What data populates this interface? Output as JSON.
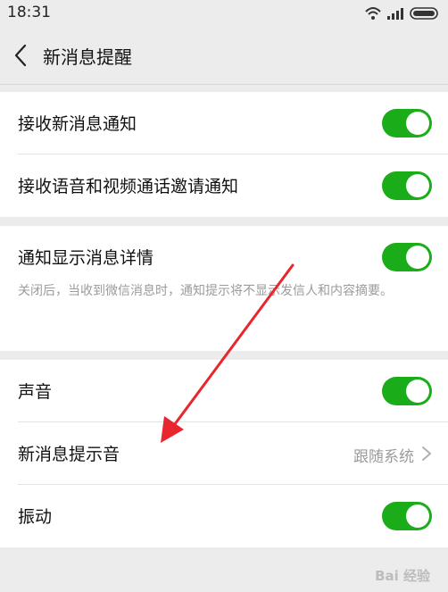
{
  "status_bar": {
    "time": "18:31"
  },
  "nav": {
    "title": "新消息提醒"
  },
  "group1": {
    "rows": [
      {
        "label": "接收新消息通知",
        "toggle": "on"
      },
      {
        "label": "接收语音和视频通话邀请通知",
        "toggle": "on"
      }
    ]
  },
  "group2": {
    "rows": [
      {
        "label": "通知显示消息详情",
        "toggle": "on",
        "description": "关闭后，当收到微信消息时，通知提示将不显示发信人和内容摘要。"
      }
    ]
  },
  "group3": {
    "rows": [
      {
        "label": "声音",
        "toggle": "on"
      },
      {
        "label": "新消息提示音",
        "value": "跟随系统"
      },
      {
        "label": "振动",
        "toggle": "on"
      }
    ]
  },
  "watermark": "Bai 经验",
  "colors": {
    "toggle_on": "#1aad19",
    "annotation_arrow": "#e8262d"
  }
}
